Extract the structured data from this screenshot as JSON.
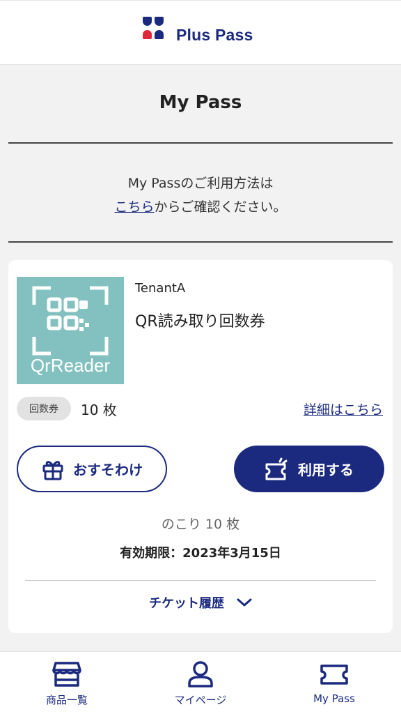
{
  "header": {
    "logo_text": "Plus Pass"
  },
  "page": {
    "title": "My Pass"
  },
  "info": {
    "line1": "My Passのご利用方法は",
    "link_text": "こちら",
    "line2_suffix": "からご確認ください。"
  },
  "ticket": {
    "thumbnail_text": "QrReader",
    "tenant": "TenantA",
    "name": "QR読み取り回数券",
    "type_badge": "回数券",
    "count_text": "10 枚",
    "details_link": "詳細はこちら",
    "share_label": "おすそわけ",
    "use_label": "利用する",
    "remaining_text": "のこり 10 枚",
    "expiry_text": "有効期限：2023年3月15日",
    "history_label": "チケット履歴"
  },
  "tabbar": {
    "items": [
      {
        "label": "商品一覧",
        "icon": "store-icon"
      },
      {
        "label": "マイページ",
        "icon": "person-icon"
      },
      {
        "label": "My Pass",
        "icon": "ticket-icon"
      }
    ]
  },
  "colors": {
    "brand_navy": "#1b2a7f",
    "brand_red": "#e0283c",
    "thumb_teal": "#82c1bf"
  }
}
